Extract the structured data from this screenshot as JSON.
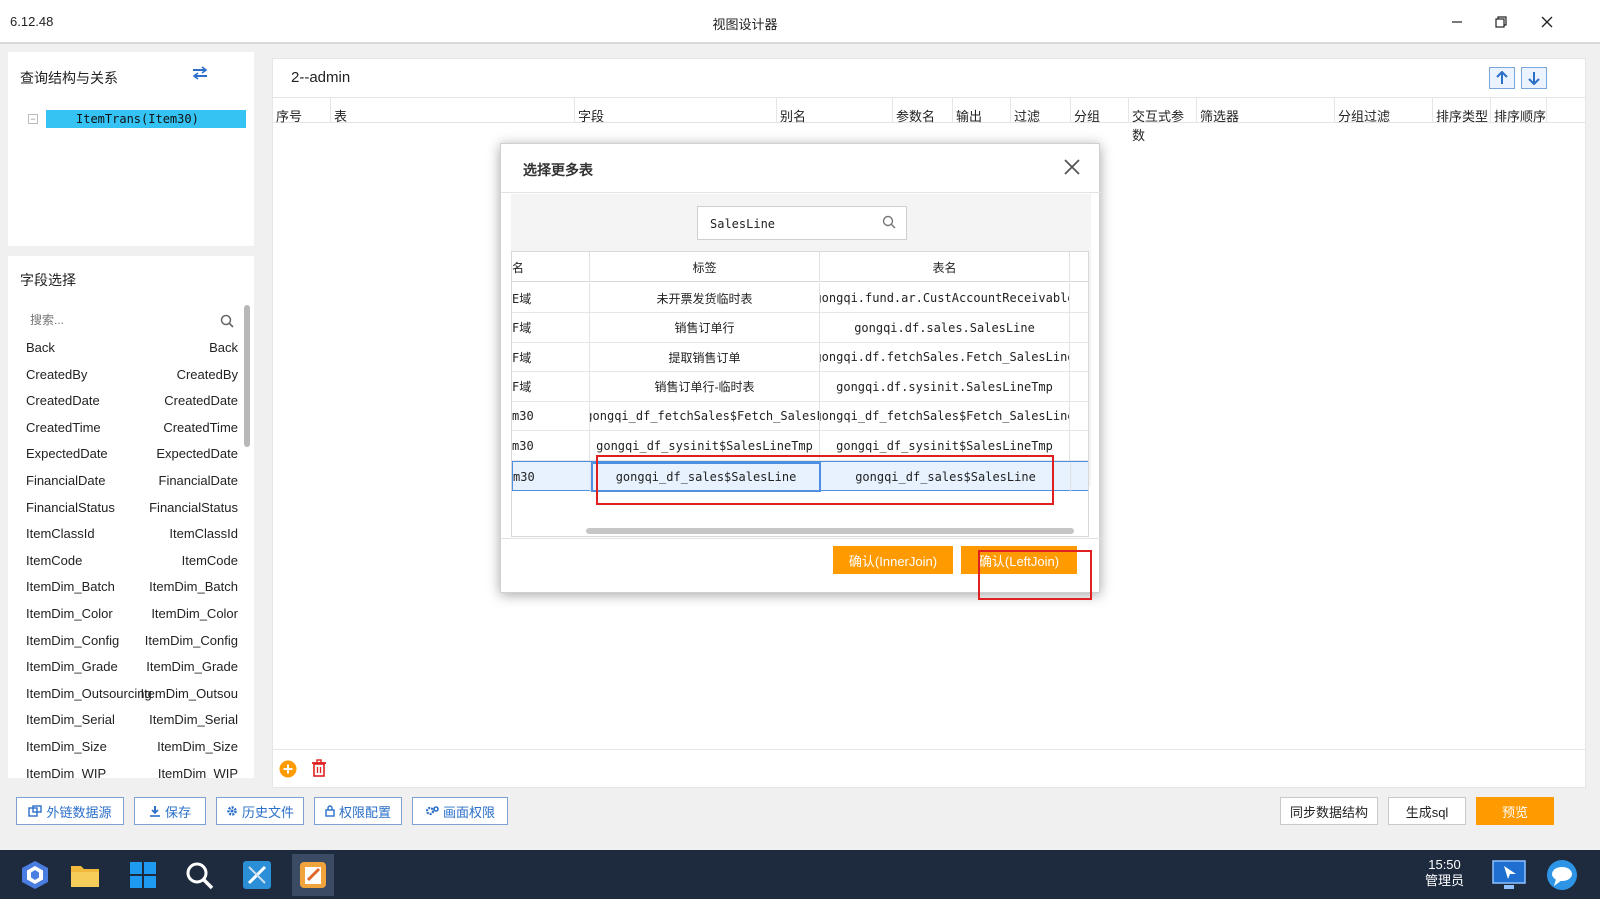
{
  "window": {
    "version": "6.12.48",
    "title": "视图设计器"
  },
  "query_panel": {
    "title": "查询结构与关系",
    "tree": [
      {
        "label": "ItemTrans(Item30)"
      }
    ]
  },
  "field_panel": {
    "title": "字段选择",
    "search_placeholder": "搜索...",
    "fields": [
      {
        "name": "Back",
        "label": "Back"
      },
      {
        "name": "CreatedBy",
        "label": "CreatedBy"
      },
      {
        "name": "CreatedDate",
        "label": "CreatedDate"
      },
      {
        "name": "CreatedTime",
        "label": "CreatedTime"
      },
      {
        "name": "ExpectedDate",
        "label": "ExpectedDate"
      },
      {
        "name": "FinancialDate",
        "label": "FinancialDate"
      },
      {
        "name": "FinancialStatus",
        "label": "FinancialStatus"
      },
      {
        "name": "ItemClassId",
        "label": "ItemClassId"
      },
      {
        "name": "ItemCode",
        "label": "ItemCode"
      },
      {
        "name": "ItemDim_Batch",
        "label": "ItemDim_Batch"
      },
      {
        "name": "ItemDim_Color",
        "label": "ItemDim_Color"
      },
      {
        "name": "ItemDim_Config",
        "label": "ItemDim_Config"
      },
      {
        "name": "ItemDim_Grade",
        "label": "ItemDim_Grade"
      },
      {
        "name": "ItemDim_Outsourcing",
        "label": "ItemDim_Outsou"
      },
      {
        "name": "ItemDim_Serial",
        "label": "ItemDim_Serial"
      },
      {
        "name": "ItemDim_Size",
        "label": "ItemDim_Size"
      },
      {
        "name": "ItemDim_WIP",
        "label": "ItemDim_WIP"
      }
    ]
  },
  "main": {
    "title": "2--admin",
    "columns": [
      "序号",
      "表",
      "字段",
      "别名",
      "参数名",
      "输出",
      "过滤",
      "分组",
      "交互式参数",
      "筛选器",
      "分组过滤",
      "排序类型",
      "排序顺序"
    ]
  },
  "dialog": {
    "title": "选择更多表",
    "search_value": "SalesLine",
    "headers": [
      "名",
      "标签",
      "表名"
    ],
    "rows": [
      {
        "c0": "E域",
        "label": "未开票发货临时表",
        "table": "gongqi.fund.ar.CustAccountReceivable"
      },
      {
        "c0": "F域",
        "label": "销售订单行",
        "table": "gongqi.df.sales.SalesLine"
      },
      {
        "c0": "F域",
        "label": "提取销售订单",
        "table": "gongqi.df.fetchSales.Fetch_SalesLine"
      },
      {
        "c0": "F域",
        "label": "销售订单行-临时表",
        "table": "gongqi.df.sysinit.SalesLineTmp"
      },
      {
        "c0": "m30",
        "label": "gongqi_df_fetchSales$Fetch_SalesL",
        "table": "gongqi_df_fetchSales$Fetch_SalesLine"
      },
      {
        "c0": "m30",
        "label": "gongqi_df_sysinit$SalesLineTmp",
        "table": "gongqi_df_sysinit$SalesLineTmp"
      },
      {
        "c0": "m30",
        "label": "gongqi_df_sales$SalesLine",
        "table": "gongqi_df_sales$SalesLine"
      }
    ],
    "btn_inner": "确认(InnerJoin)",
    "btn_left": "确认(LeftJoin)"
  },
  "toolbar": {
    "external": "外链数据源",
    "save": "保存",
    "history": "历史文件",
    "permission": "权限配置",
    "screen_permission": "画面权限",
    "sync": "同步数据结构",
    "gen_sql": "生成sql",
    "preview": "预览"
  },
  "taskbar": {
    "time": "15:50",
    "user": "管理员"
  },
  "colors": {
    "accent": "#ff9a00",
    "selection": "#35c3f3",
    "link": "#2b6fc9",
    "highlight": "#e02020"
  }
}
